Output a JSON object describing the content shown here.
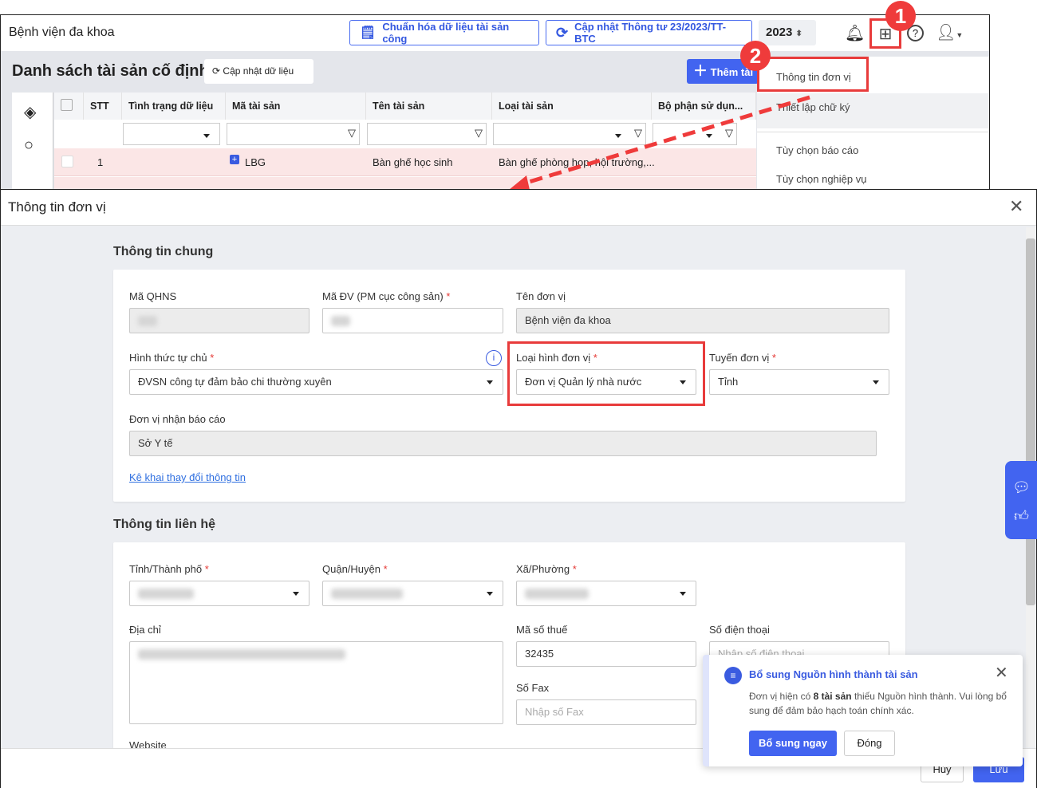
{
  "topbar": {
    "title": "Bệnh viện đa khoa",
    "btn_standardize": "Chuẩn hóa dữ liệu tài sản công",
    "btn_update_circular": "Cập nhật Thông tư 23/2023/TT-BTC",
    "year": "2023"
  },
  "list": {
    "title": "Danh sách tài sản cố định",
    "refresh_label": "Cập nhật dữ liệu",
    "add_label": "Thêm tài",
    "columns": [
      "STT",
      "Tình trạng dữ liệu",
      "Mã tài sản",
      "Tên tài sản",
      "Loại tài sản",
      "Bộ phận sử dụn..."
    ],
    "rows": [
      {
        "stt": "1",
        "code": "LBG",
        "name": "Bàn ghế học sinh",
        "type": "Bàn ghế phòng họp, hội trường,..."
      }
    ]
  },
  "menu": {
    "items": [
      "Thông tin đơn vị",
      "Thiết lập chữ ký",
      "Tùy chọn báo cáo",
      "Tùy chọn nghiệp vụ"
    ]
  },
  "badges": [
    "1",
    "2"
  ],
  "modal": {
    "title": "Thông tin đơn vị",
    "general": {
      "heading": "Thông tin chung",
      "ma_qhns": "Mã QHNS",
      "ma_dv": "Mã ĐV (PM cục công sản)",
      "ten_dv": "Tên đơn vị",
      "ten_dv_value": "Bệnh viện đa khoa",
      "hinh_thuc": "Hình thức tự chủ",
      "hinh_thuc_value": "ĐVSN công tự đảm bảo chi thường xuyên",
      "loai_hinh": "Loại hình đơn vị",
      "loai_hinh_value": "Đơn vị Quản lý nhà nước",
      "tuyen": "Tuyến đơn vị",
      "tuyen_value": "Tỉnh",
      "nhan_bc": "Đơn vị nhận báo cáo",
      "nhan_bc_value": "Sở Y tế",
      "link": "Kê khai thay đổi thông tin",
      "required": "*"
    },
    "contact": {
      "heading": "Thông tin liên hệ",
      "tinh": "Tỉnh/Thành phố",
      "huyen": "Quận/Huyện",
      "xa": "Xã/Phường",
      "dia_chi": "Địa chỉ",
      "mst": "Mã số thuế",
      "mst_value": "32435",
      "sdt": "Số điện thoại",
      "sdt_placeholder": "Nhập số điện thoại",
      "fax": "Số Fax",
      "fax_placeholder": "Nhập số Fax",
      "website": "Website"
    },
    "footer": {
      "cancel": "Hủy",
      "save": "Lưu"
    }
  },
  "toast": {
    "title": "Bổ sung Nguồn hình thành tài sản",
    "msg_pre": "Đơn vị hiện có ",
    "msg_bold": "8 tài sản",
    "msg_post": " thiếu Nguồn hình thành. Vui lòng bổ sung để đảm bảo hạch toán chính xác.",
    "primary": "Bổ sung ngay",
    "secondary": "Đóng"
  }
}
